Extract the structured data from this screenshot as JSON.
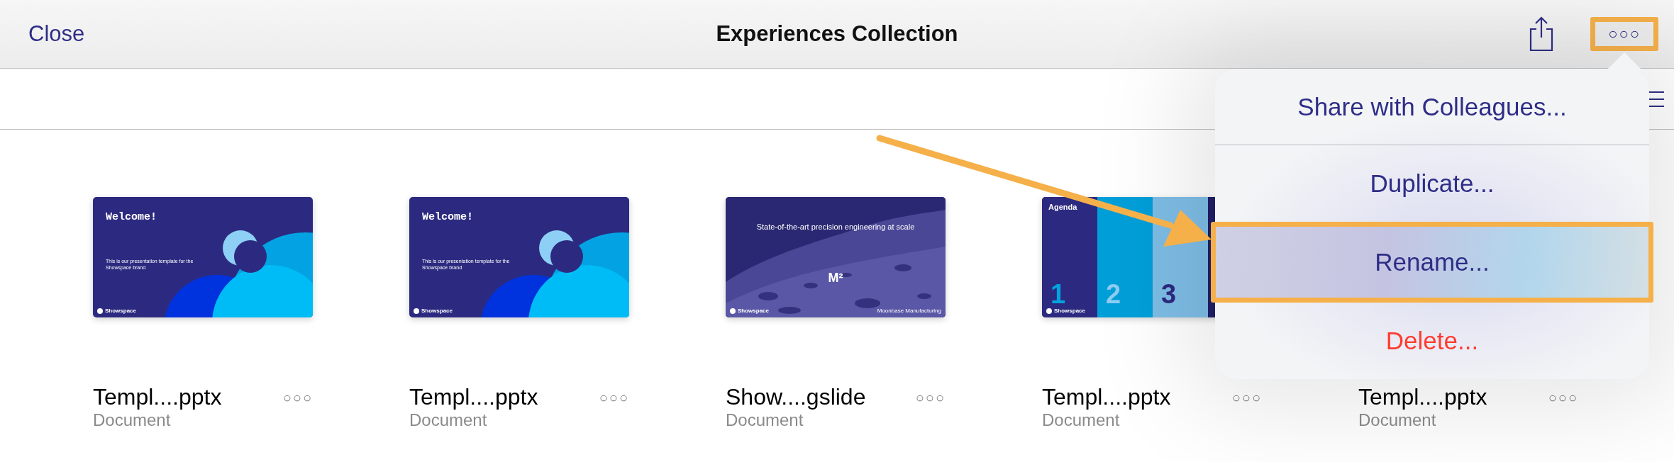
{
  "navbar": {
    "left_button": "Close",
    "title": "Experiences Collection",
    "more_button": {
      "label": "○○○",
      "annotated": true
    }
  },
  "files": [
    {
      "name": "Templ....pptx",
      "type": "Document",
      "more": "○○○",
      "slide": {
        "kind": "welcome",
        "title": "Welcome!",
        "body": "This is our presentation template for the Showspace brand",
        "brand": "Showspace"
      }
    },
    {
      "name": "Templ....pptx",
      "type": "Document",
      "more": "○○○",
      "slide": {
        "kind": "welcome",
        "title": "Welcome!",
        "body": "This is our presentation template for the Showspace brand",
        "brand": "Showspace"
      }
    },
    {
      "name": "Show....gslide",
      "type": "Document",
      "more": "○○○",
      "slide": {
        "title": "State-of-the-art precision engineering at scale",
        "mark": "M²",
        "footer": "Moonbase Manufacturing",
        "brand": "Showspace"
      }
    },
    {
      "name": "Templ....pptx",
      "type": "Document",
      "more": "○○○",
      "slide": {
        "kind": "agenda",
        "title": "Agenda",
        "brand": "Showspace",
        "columns": [
          {
            "number": "1",
            "color": "#2c2a80"
          },
          {
            "number": "2",
            "color": "#009fd9"
          },
          {
            "number": "3",
            "color": "#7ebde6"
          }
        ]
      }
    },
    {
      "name": "Templ....pptx",
      "type": "Document",
      "more": "○○○"
    }
  ],
  "menu": {
    "items": [
      {
        "label": "Share with Colleagues...",
        "kind": "normal",
        "selected": false,
        "annotated": false
      },
      {
        "label": "Duplicate...",
        "kind": "normal",
        "selected": false,
        "annotated": false
      },
      {
        "label": "Rename...",
        "kind": "normal",
        "selected": true,
        "annotated": true
      },
      {
        "label": "Delete...",
        "kind": "destructive",
        "selected": false,
        "annotated": false
      }
    ]
  },
  "annotation_arrow": true
}
